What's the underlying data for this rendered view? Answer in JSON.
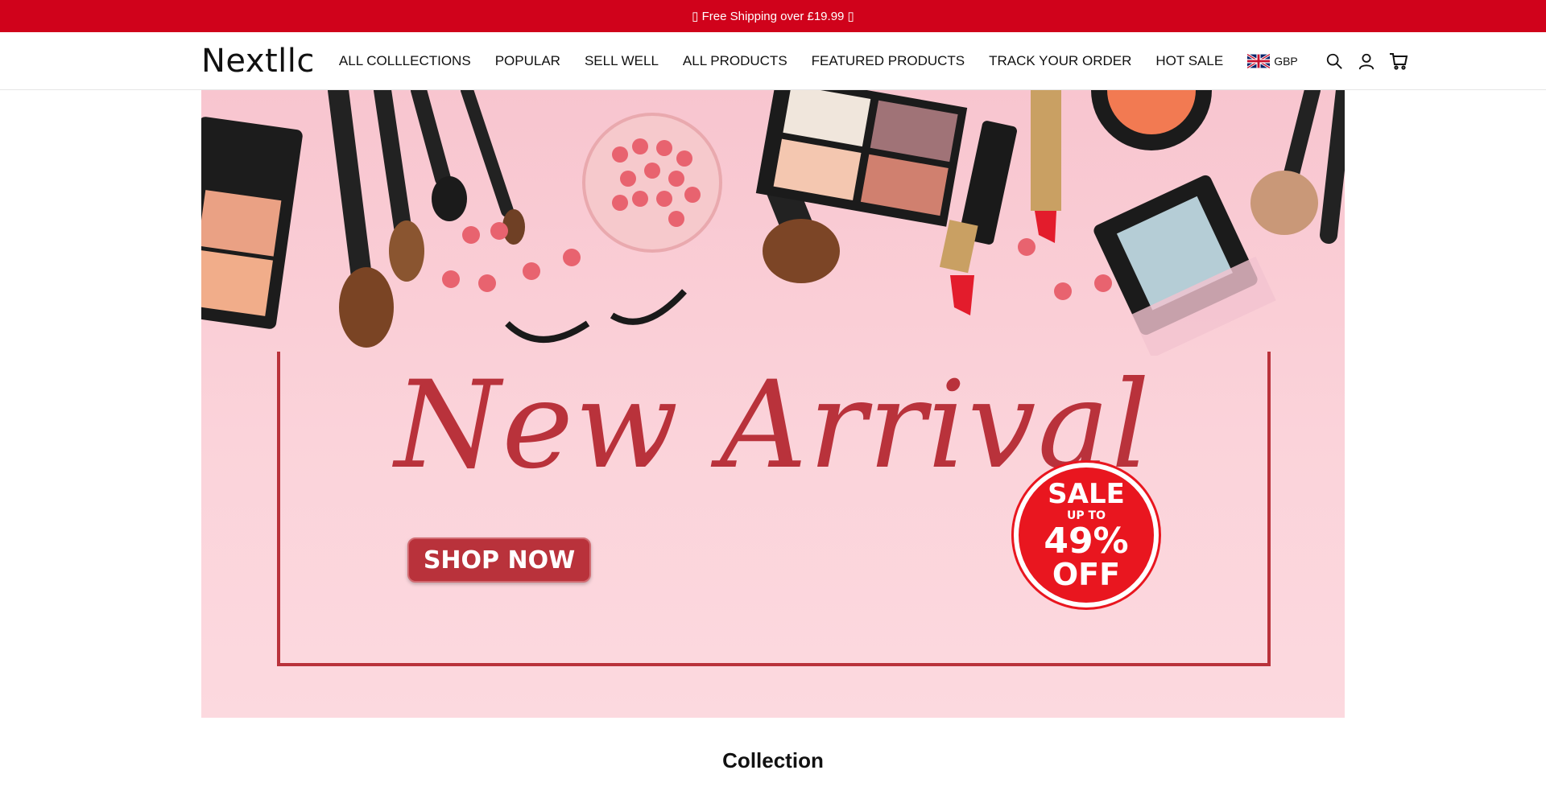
{
  "announcement": {
    "text": "▯ Free Shipping over £19.99 ▯"
  },
  "header": {
    "logo": "Nextllc",
    "nav": [
      {
        "label": "ALL COLLLECTIONS"
      },
      {
        "label": "POPULAR"
      },
      {
        "label": "SELL WELL"
      },
      {
        "label": "ALL PRODUCTS"
      },
      {
        "label": "FEATURED PRODUCTS"
      },
      {
        "label": "TRACK YOUR ORDER"
      },
      {
        "label": "HOT SALE"
      }
    ],
    "currency": "GBP",
    "icons": [
      "uk-flag-icon",
      "search-icon",
      "account-icon",
      "cart-icon"
    ]
  },
  "banner": {
    "headline": "New Arrival",
    "cta": "SHOP NOW",
    "badge": {
      "line1": "SALE",
      "line2": "UP TO",
      "line3": "49%",
      "line4": "OFF"
    },
    "colors": {
      "accent": "#b9323b",
      "background": "#fbd3da",
      "badge": "#e9161f"
    }
  },
  "section": {
    "title": "Collection"
  },
  "colors": {
    "announcement_bg": "#d0021b"
  }
}
